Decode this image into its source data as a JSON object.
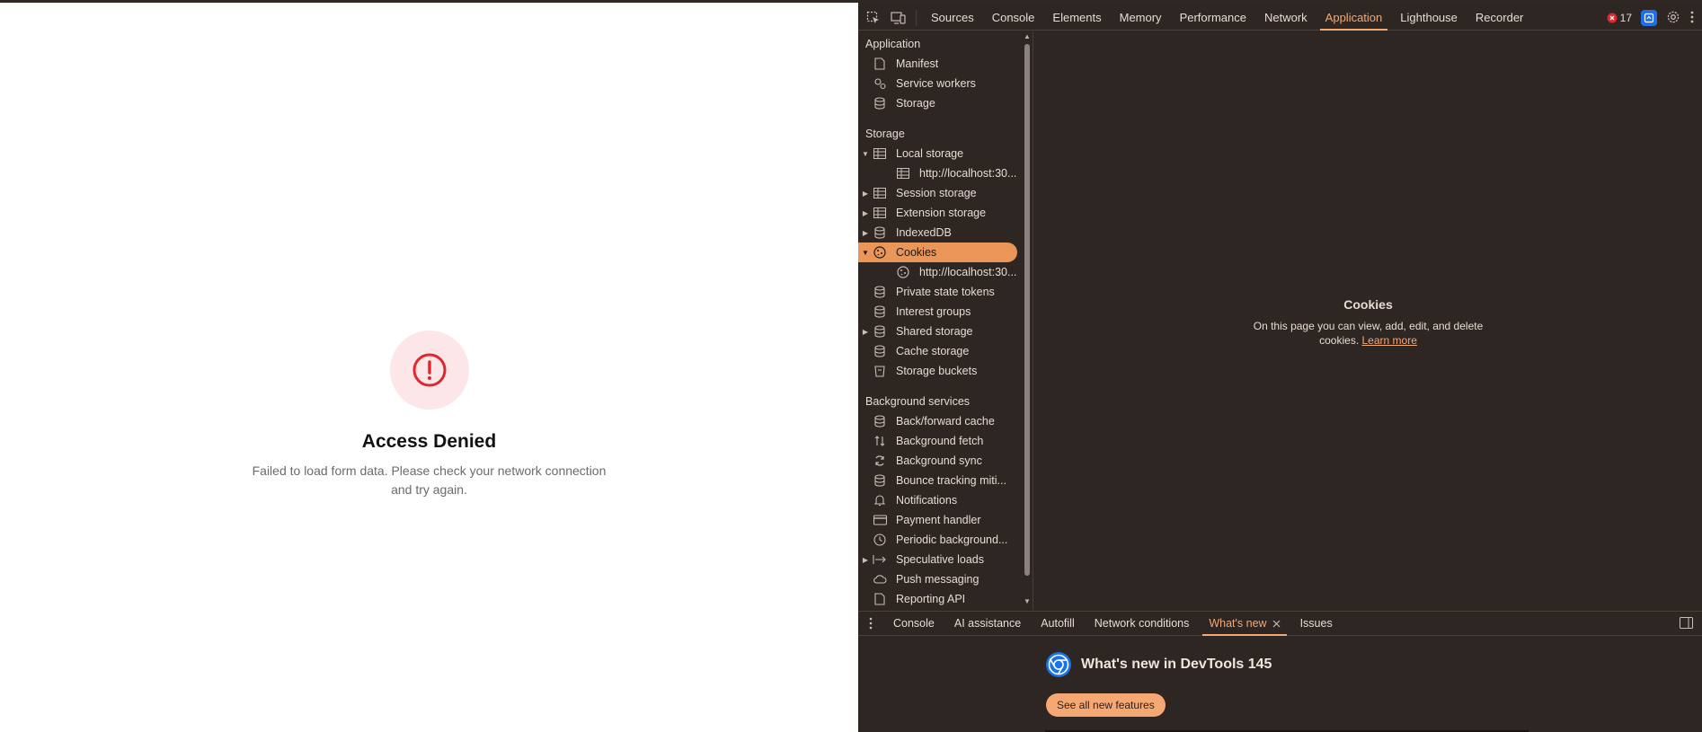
{
  "page": {
    "error_title": "Access Denied",
    "error_message": "Failed to load form data. Please check your network connection and try again.",
    "error_icon": "alert-circle-icon"
  },
  "devtools": {
    "tabs": [
      "Sources",
      "Console",
      "Elements",
      "Memory",
      "Performance",
      "Network",
      "Application",
      "Lighthouse",
      "Recorder"
    ],
    "active_tab": "Application",
    "error_count": "17",
    "sidebar": {
      "application_header": "Application",
      "application_items": [
        "Manifest",
        "Service workers",
        "Storage"
      ],
      "storage_header": "Storage",
      "storage_items": {
        "local_storage": "Local storage",
        "local_storage_child": "http://localhost:30...",
        "session_storage": "Session storage",
        "extension_storage": "Extension storage",
        "indexeddb": "IndexedDB",
        "cookies": "Cookies",
        "cookies_child": "http://localhost:30...",
        "private_state_tokens": "Private state tokens",
        "interest_groups": "Interest groups",
        "shared_storage": "Shared storage",
        "cache_storage": "Cache storage",
        "storage_buckets": "Storage buckets"
      },
      "background_header": "Background services",
      "background_items": {
        "bfcache": "Back/forward cache",
        "background_fetch": "Background fetch",
        "background_sync": "Background sync",
        "bounce_tracking": "Bounce tracking miti...",
        "notifications": "Notifications",
        "payment_handler": "Payment handler",
        "periodic_sync": "Periodic background...",
        "speculative_loads": "Speculative loads",
        "push_messaging": "Push messaging",
        "reporting_api": "Reporting API"
      }
    },
    "main": {
      "title": "Cookies",
      "description": "On this page you can view, add, edit, and delete cookies.",
      "learn_more": "Learn more"
    },
    "drawer": {
      "tabs": [
        "Console",
        "AI assistance",
        "Autofill",
        "Network conditions",
        "What's new",
        "Issues"
      ],
      "active_tab": "What's new",
      "whats_new_title": "What's new in DevTools 145",
      "see_all_button": "See all new features"
    },
    "colors": {
      "accent": "#f5a873",
      "selected_row": "#e99658",
      "panel_bg": "#2e2622",
      "error_red": "#e0262f",
      "error_bg": "#fde6e8"
    }
  }
}
